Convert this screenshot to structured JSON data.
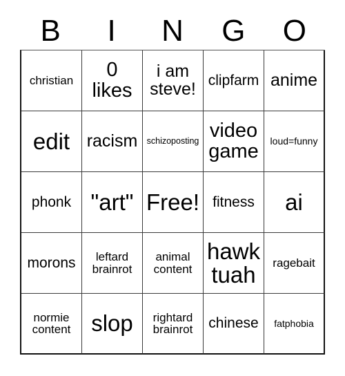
{
  "card": {
    "title_letters": [
      "B",
      "I",
      "N",
      "G",
      "O"
    ],
    "free_space_label": "Free!",
    "grid": [
      [
        {
          "label": "christian",
          "size": "sm"
        },
        {
          "label": "0 likes",
          "size": "xl"
        },
        {
          "label": "i am steve!",
          "size": "lg"
        },
        {
          "label": "clipfarm",
          "size": "md"
        },
        {
          "label": "anime",
          "size": "lg"
        }
      ],
      [
        {
          "label": "edit",
          "size": "xxl"
        },
        {
          "label": "racism",
          "size": "lg"
        },
        {
          "label": "schizoposting",
          "size": "xxs"
        },
        {
          "label": "video game",
          "size": "xl"
        },
        {
          "label": "loud=funny",
          "size": "xs"
        }
      ],
      [
        {
          "label": "phonk",
          "size": "md"
        },
        {
          "label": "\"art\"",
          "size": "xxl"
        },
        {
          "label": "Free!",
          "size": "xxl"
        },
        {
          "label": "fitness",
          "size": "md"
        },
        {
          "label": "ai",
          "size": "xxl"
        }
      ],
      [
        {
          "label": "morons",
          "size": "md"
        },
        {
          "label": "leftard brainrot",
          "size": "sm"
        },
        {
          "label": "animal content",
          "size": "sm"
        },
        {
          "label": "hawk tuah",
          "size": "xxl"
        },
        {
          "label": "ragebait",
          "size": "sm"
        }
      ],
      [
        {
          "label": "normie content",
          "size": "sm"
        },
        {
          "label": "slop",
          "size": "xxl"
        },
        {
          "label": "rightard brainrot",
          "size": "sm"
        },
        {
          "label": "chinese",
          "size": "md"
        },
        {
          "label": "fatphobia",
          "size": "xs"
        }
      ]
    ]
  },
  "colors": {
    "background": "#ffffff",
    "text": "#000000",
    "grid_line": "#111111",
    "grid_line_inner": "#3a3a3a"
  }
}
